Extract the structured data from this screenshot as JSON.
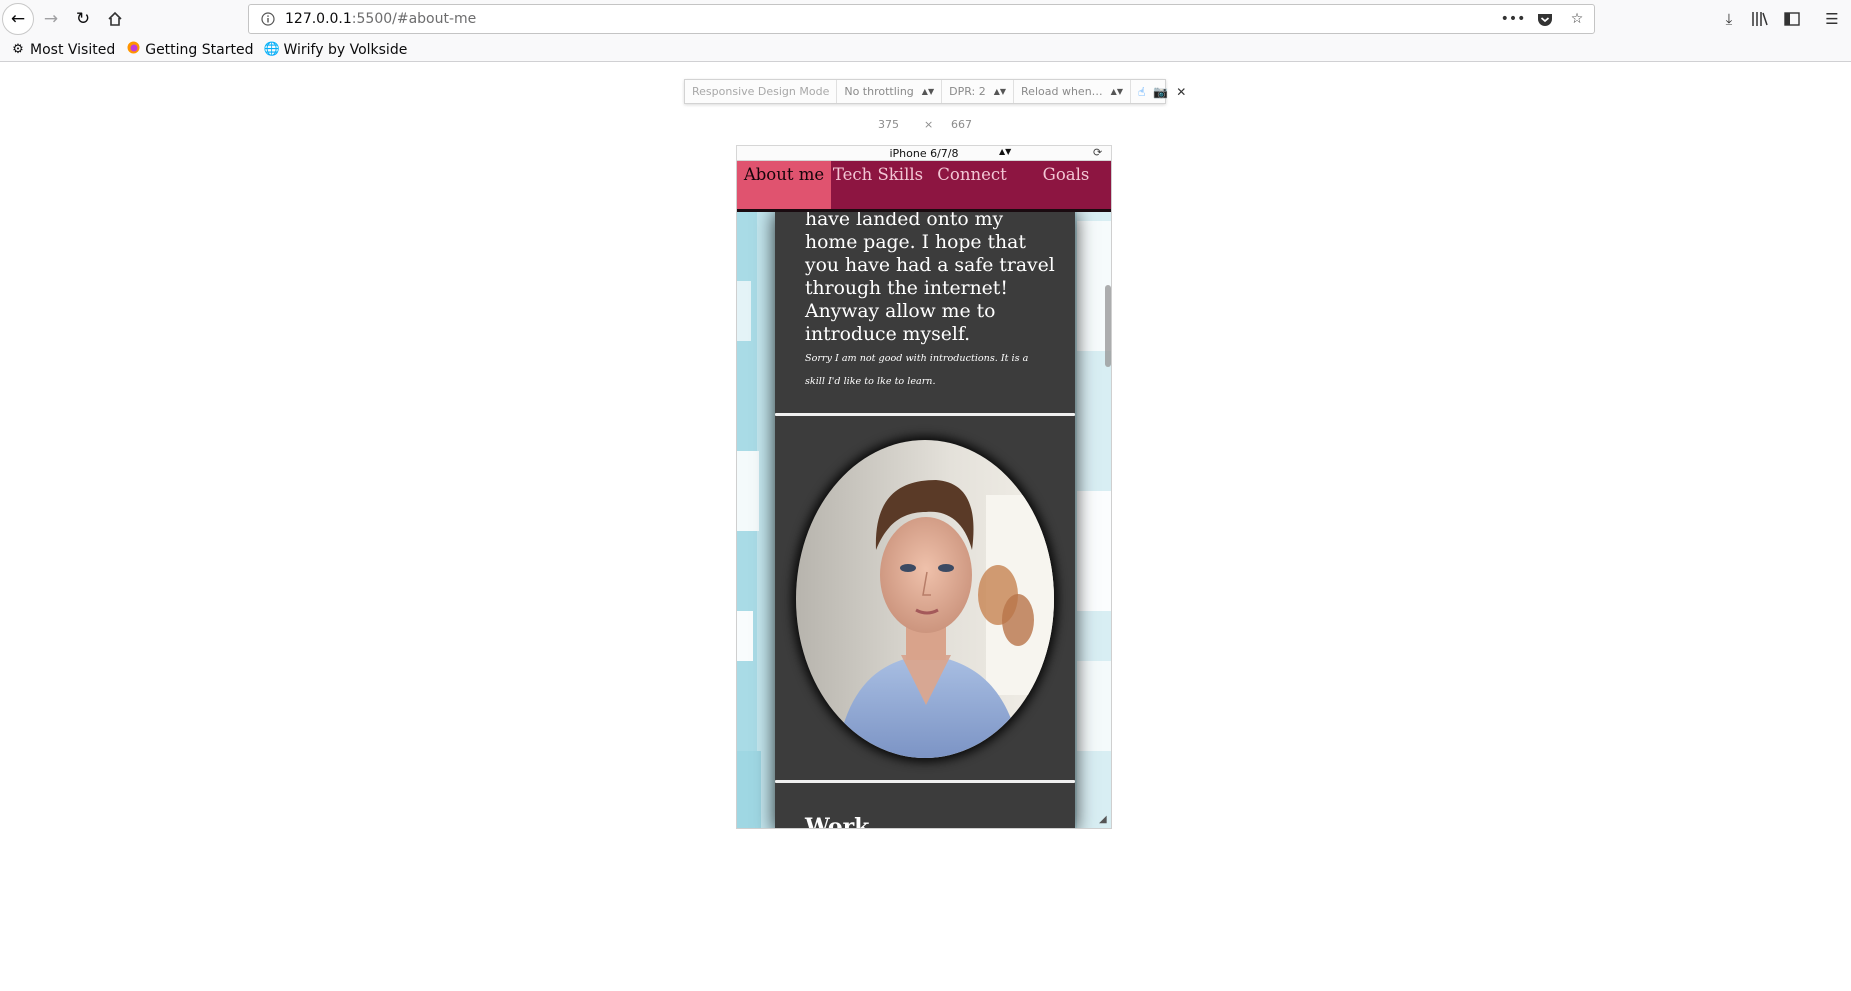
{
  "browser": {
    "url_host": "127.0.0.1",
    "url_rest": ":5500/#about-me",
    "bookmarks": [
      {
        "icon": "gear-icon",
        "label": "Most Visited"
      },
      {
        "icon": "firefox-icon",
        "label": "Getting Started"
      },
      {
        "icon": "globe-icon",
        "label": "Wirify by Volkside"
      }
    ]
  },
  "rdm": {
    "title": "Responsive Design Mode",
    "throttling": "No throttling",
    "dpr": "DPR: 2",
    "reload": "Reload when…",
    "width": "375",
    "times": "×",
    "height": "667",
    "device": "iPhone 6/7/8"
  },
  "page": {
    "nav": [
      "About me",
      "Tech Skills",
      "Connect",
      "Goals"
    ],
    "active_nav": "About me",
    "intro_text": "have landed onto my home page. I hope that you have had a safe travel through the internet! Anyway allow me to introduce myself.",
    "intro_small": "Sorry I am not good with introductions. It is a skill I'd like to lke to learn.",
    "work_heading": "Work",
    "colors": {
      "nav_bg": "#8d1541",
      "nav_active": "#e0536f",
      "card_bg": "#3c3c3c",
      "page_bg": "#c3e6ee"
    }
  }
}
